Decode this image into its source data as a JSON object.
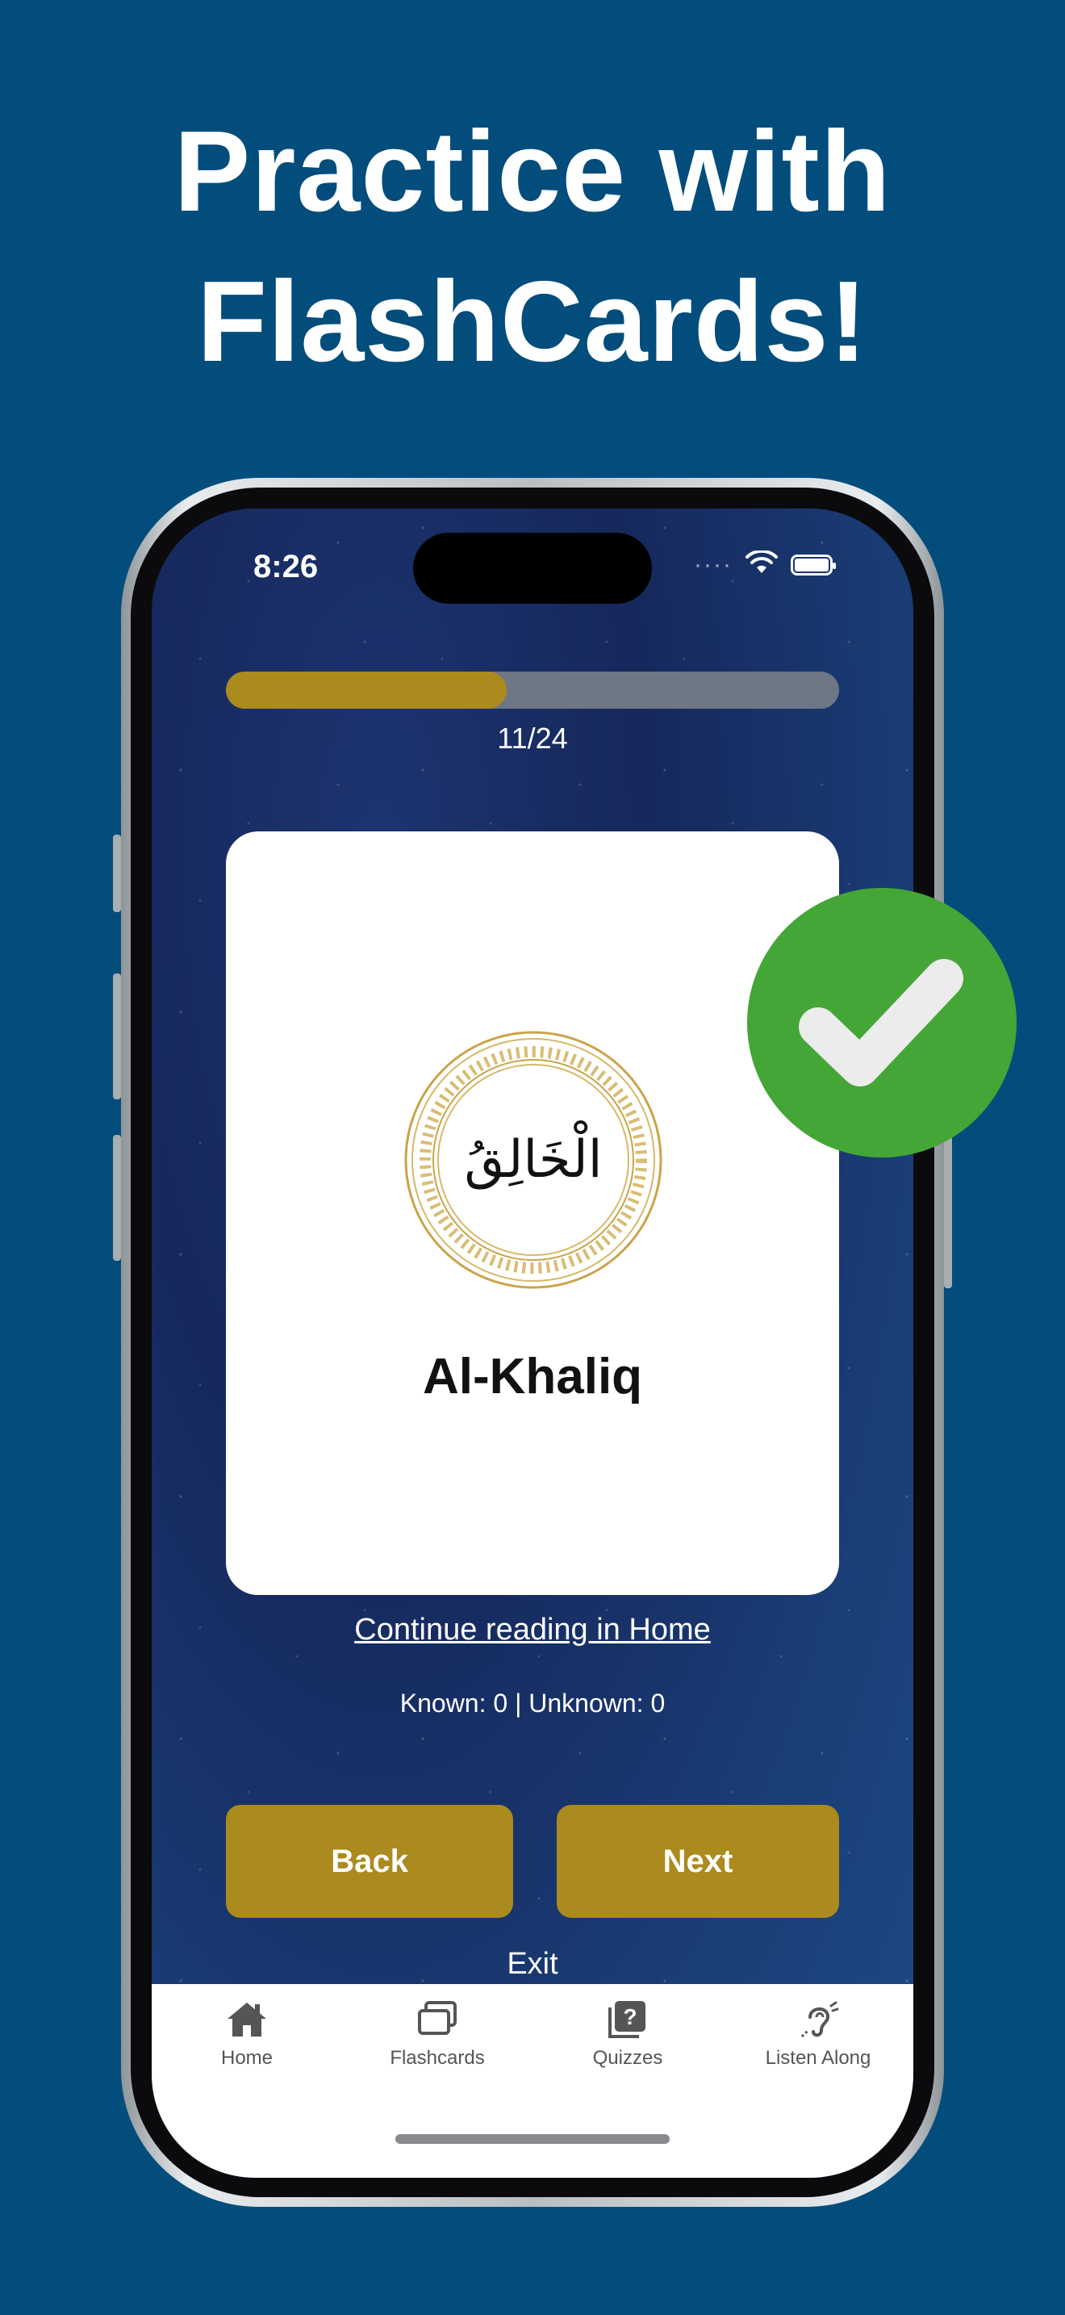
{
  "headline": {
    "line1": "Practice with",
    "line2": "FlashCards!"
  },
  "status_bar": {
    "time": "8:26",
    "signal": "····"
  },
  "progress": {
    "text": "11/24",
    "fraction": 0.458
  },
  "card": {
    "arabic": "الْخَالِقُ",
    "name": "Al-Khaliq"
  },
  "links": {
    "continue": "Continue reading in Home"
  },
  "counts": {
    "text": "Known: 0 | Unknown: 0"
  },
  "buttons": {
    "back": "Back",
    "next": "Next",
    "exit": "Exit"
  },
  "tabs": [
    {
      "label": "Home",
      "icon": "home-icon"
    },
    {
      "label": "Flashcards",
      "icon": "flashcards-icon"
    },
    {
      "label": "Quizzes",
      "icon": "quiz-icon"
    },
    {
      "label": "Listen Along",
      "icon": "ear-icon"
    }
  ],
  "colors": {
    "background": "#024d7c",
    "accent_gold": "#ab8a1e",
    "check_green": "#44a636"
  }
}
